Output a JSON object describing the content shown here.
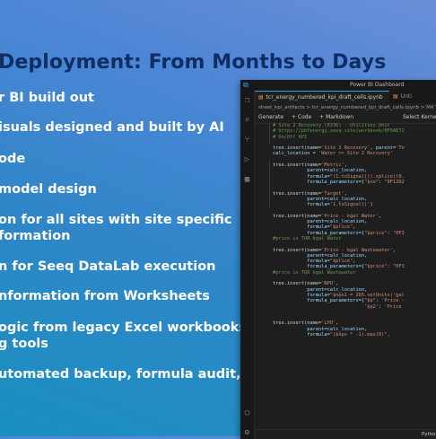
{
  "slide": {
    "title": "Deployment: From Months to Days",
    "bullets": [
      "r BI build out",
      "isuals designed and built by AI",
      "ode",
      " model design",
      "on for all sites with site specific",
      "formation",
      "n for Seeq DataLab execution",
      "nformation from Worksheets",
      "ogic from legacy Excel workbooks",
      "g tools",
      "utomated backup, formula audit,"
    ]
  },
  "window": {
    "title": "Power BI Dashboard",
    "tabs": [
      "tcr_energy_numbered_kpi_draft_cells.ipynb",
      "Unti"
    ],
    "breadcrumb": "sheet_kpi_artifacts > tcr_energy_numbered_kpi_draft_cells.ipynb > M4 Ti",
    "toolbar": {
      "generate": "Generate",
      "code": "+ Code",
      "markdown": "+ Markdown",
      "select_kernel": "Select Kerne"
    },
    "status_language": "Python"
  },
  "code_lines": [
    "# Site 2 Recovery (6336) - Utilities Unit",
    "# https://pbfenergy.seeq.site/workbook/0F0AE72",
    "# On/Off KPI",
    "",
    "tree.insert(name='Site 2 Recovery', parent='To",
    "calc_location = 'Water >> Site 2 Recovery'",
    "",
    "tree.insert(name='Metric',",
    "            parent=calc_location,",
    "            formula=\"(1.toSignal()).splice((0.",
    "            formula_parameters={\"$oo\": \"0F12D2",
    "",
    "tree.insert(name='Target',",
    "            parent=calc_location,",
    "            formula='1.toSignal()')",
    "",
    "tree.insert(name='Price - kgal Water',",
    "            parent=calc_location,",
    "            formula=\"$price\",",
    "            formula_parameters={\"$price\": \"0F3",
    "#price is TOR kgal Water",
    "",
    "tree.insert(name='Price - kgal Wastewater',",
    "            parent=calc_location,",
    "            formula=\"$price\",",
    "            formula_parameters={\"$price\": \"0F3",
    "#price is TOR kgal Wastewater",
    "",
    "tree.insert(name='NPO',",
    "            parent=calc_location,",
    "            formula=\"$npo1 = 265.setUnits('gal",
    "            formula_parameters={\"$p\": 'Price -",
    "                                '$p2': 'Price",
    "",
    "",
    "tree.insert(name='LPO',",
    "            parent=calc_location,",
    "            formula=\"($npo * -1).max(0)\","
  ],
  "icons": [
    "vscode-logo",
    "explorer-icon",
    "search-icon",
    "source-control-icon",
    "run-debug-icon",
    "extensions-icon",
    "account-icon",
    "settings-icon"
  ]
}
